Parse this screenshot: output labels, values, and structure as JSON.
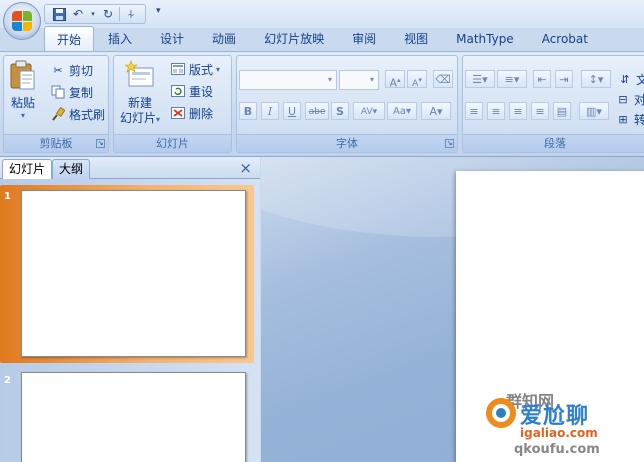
{
  "quick_access": {
    "save_icon": "save-icon",
    "undo_icon": "undo-icon",
    "redo_icon": "redo-icon",
    "pin_icon": "pin-icon",
    "more_icon": "customize-dropdown-icon"
  },
  "ribbon_tabs": [
    {
      "label": "开始",
      "active": true
    },
    {
      "label": "插入"
    },
    {
      "label": "设计"
    },
    {
      "label": "动画"
    },
    {
      "label": "幻灯片放映"
    },
    {
      "label": "审阅"
    },
    {
      "label": "视图"
    },
    {
      "label": "MathType"
    },
    {
      "label": "Acrobat"
    }
  ],
  "clipboard": {
    "paste_label": "粘贴",
    "cut_label": "剪切",
    "copy_label": "复制",
    "format_painter_label": "格式刷",
    "group_label": "剪贴板"
  },
  "slides_group": {
    "new_slide_label_1": "新建",
    "new_slide_label_2": "幻灯片",
    "layout_label": "版式",
    "reset_label": "重设",
    "delete_label": "删除",
    "group_label": "幻灯片"
  },
  "font_group": {
    "font_name_value": "",
    "font_size_value": "",
    "grow_label": "A",
    "shrink_label": "A",
    "bold_label": "B",
    "italic_label": "I",
    "underline_label": "U",
    "strike_label": "abe",
    "shadow_label": "S",
    "spacing_label": "AV",
    "case_label": "Aa",
    "color_label": "A",
    "group_label": "字体"
  },
  "paragraph_group": {
    "group_label": "段落",
    "text_dir_label": "文",
    "align_text_label": "对",
    "smartart_label": "转"
  },
  "slide_pane": {
    "tab_slides": "幻灯片",
    "tab_outline": "大纲",
    "close_symbol": "×",
    "slides": [
      {
        "number": "1",
        "selected": true
      },
      {
        "number": "2",
        "selected": false
      }
    ]
  },
  "watermark": {
    "line1": "爱尬聊",
    "line2": "igaliao.com",
    "line3": "qkoufu.com",
    "partial_text": "群知网"
  },
  "colors": {
    "ribbon_text": "#15428b",
    "selected_slide": "#e07a1f",
    "workspace": "#95b2d9"
  }
}
